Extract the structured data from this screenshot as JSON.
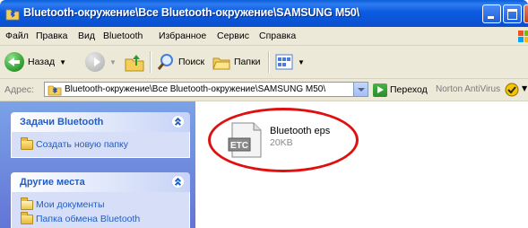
{
  "window": {
    "title": "Bluetooth-окружение\\Все Bluetooth-окружение\\SAMSUNG M50\\"
  },
  "menu": {
    "items": [
      "Файл",
      "Правка",
      "Вид",
      "Bluetooth",
      "Избранное",
      "Сервис",
      "Справка"
    ]
  },
  "toolbar": {
    "back_label": "Назад",
    "search_label": "Поиск",
    "folders_label": "Папки"
  },
  "address": {
    "label": "Адрес:",
    "value": "Bluetooth-окружение\\Все Bluetooth-окружение\\SAMSUNG M50\\",
    "go_label": "Переход",
    "antivirus_label": "Norton AntiVirus"
  },
  "tasks_panel": {
    "title": "Задачи Bluetooth",
    "items": [
      "Создать новую папку"
    ]
  },
  "places_panel": {
    "title": "Другие места",
    "items": [
      "Мои документы",
      "Папка обмена Bluetooth"
    ]
  },
  "file": {
    "name": "Bluetooth eps",
    "size": "20KB",
    "icon_label": "ETC"
  },
  "colors": {
    "titlebar": "#0a5fd8",
    "task_pane": "#7ba2e7",
    "highlight": "#e01010",
    "link": "#215dc6"
  }
}
